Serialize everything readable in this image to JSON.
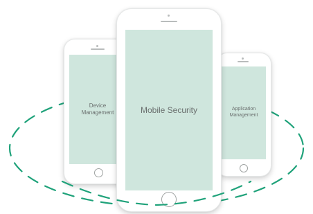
{
  "diagram": {
    "colors": {
      "screen": "#cfe6dd",
      "orbit": "#1fa27a",
      "text": "#6a6f6e"
    },
    "phones": {
      "left": {
        "label_line1": "Device",
        "label_line2": "Management"
      },
      "center": {
        "label": "Mobile Security"
      },
      "right": {
        "label_line1": "Application",
        "label_line2": "Management"
      }
    }
  }
}
